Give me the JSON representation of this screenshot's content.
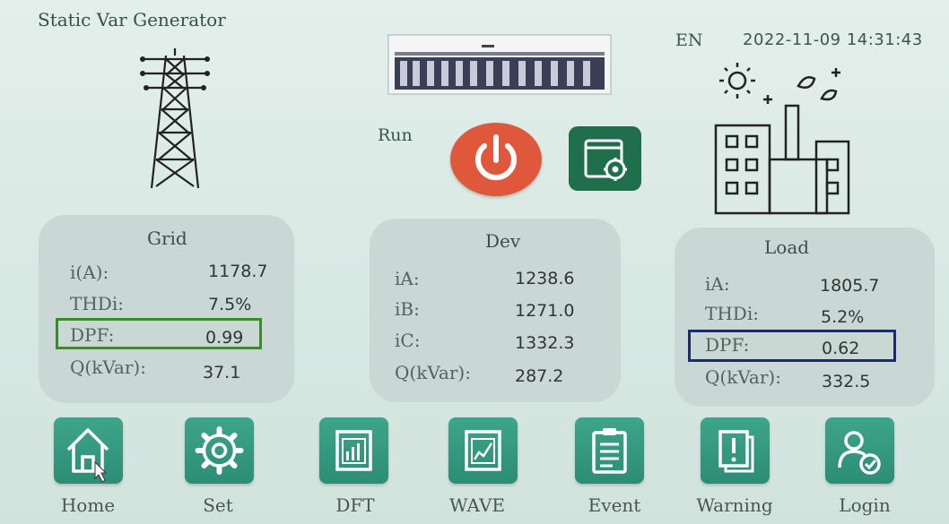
{
  "header": {
    "title": "Static Var Generator",
    "language": "EN",
    "datetime": "2022-11-09 14:31:43"
  },
  "control": {
    "run_label": "Run",
    "power_icon": "power-icon",
    "settings_icon": "window-gear-icon"
  },
  "panels": {
    "grid": {
      "title": "Grid",
      "rows": [
        {
          "label": "i(A):",
          "value": "1178.7"
        },
        {
          "label": "THDi:",
          "value": "7.5%"
        },
        {
          "label": "DPF:",
          "value": "0.99"
        },
        {
          "label": "Q(kVar):",
          "value": "37.1"
        }
      ]
    },
    "dev": {
      "title": "Dev",
      "rows": [
        {
          "label": "iA:",
          "value": "1238.6"
        },
        {
          "label": "iB:",
          "value": "1271.0"
        },
        {
          "label": "iC:",
          "value": "1332.3"
        },
        {
          "label": "Q(kVar):",
          "value": "287.2"
        }
      ]
    },
    "load": {
      "title": "Load",
      "rows": [
        {
          "label": "iA:",
          "value": "1805.7"
        },
        {
          "label": "THDi:",
          "value": "5.2%"
        },
        {
          "label": "DPF:",
          "value": "0.62"
        },
        {
          "label": "Q(kVar):",
          "value": "332.5"
        }
      ]
    }
  },
  "nav": [
    {
      "label": "Home",
      "icon": "home-icon"
    },
    {
      "label": "Set",
      "icon": "gear-icon"
    },
    {
      "label": "DFT",
      "icon": "bar-chart-icon"
    },
    {
      "label": "WAVE",
      "icon": "line-chart-icon"
    },
    {
      "label": "Event",
      "icon": "clipboard-icon"
    },
    {
      "label": "Warning",
      "icon": "alert-icon"
    },
    {
      "label": "Login",
      "icon": "user-check-icon"
    }
  ],
  "colors": {
    "power_button": "#e0583b",
    "nav_button": "#2c8d74",
    "settings_button": "#1f6e4c",
    "grid_highlight": "#3e8a2a",
    "load_highlight": "#1c2a72"
  }
}
